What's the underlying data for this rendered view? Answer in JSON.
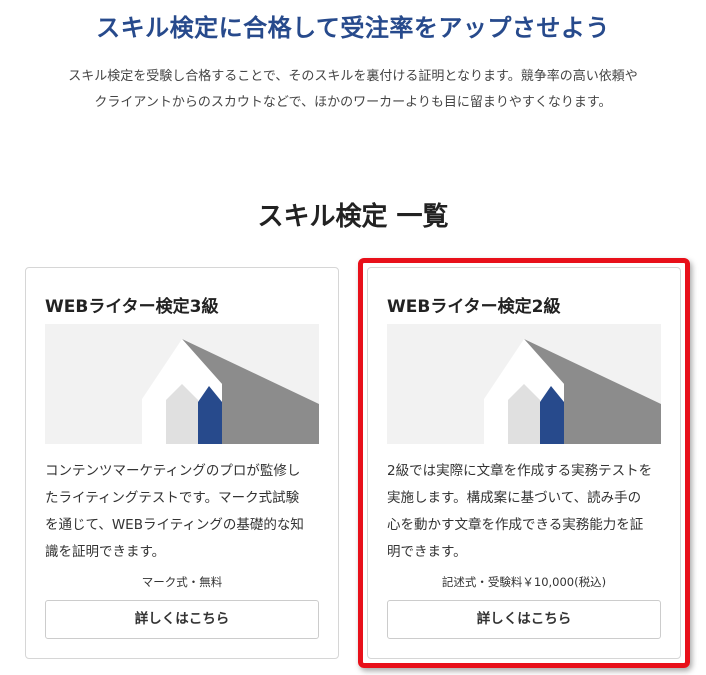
{
  "header": {
    "headline": "スキル検定に合格して受注率をアップさせよう",
    "intro_lines": [
      "スキル検定を受験し合格することで、そのスキルを裏付ける証明となります。競争率の高い依頼や",
      "クライアントからのスカウトなどで、ほかのワーカーよりも目に留まりやすくなります。"
    ]
  },
  "section": {
    "title": "スキル検定 一覧"
  },
  "cards": [
    {
      "title": "WEBライター検定3級",
      "description_lines": [
        "コンテンツマーケティングのプロが監修し",
        "たライティングテストです。マーク式試験",
        "を通じて、WEBライティングの基礎的な知",
        "識を証明できます。"
      ],
      "exam_type": "マーク式・無料",
      "button_label": "詳しくはこちら"
    },
    {
      "title": "WEBライター検定2級",
      "description_lines": [
        "2級では実際に文章を作成する実務テストを",
        "実施します。構成案に基づいて、読み手の",
        "心を動かす文章を作成できる実務能力を証",
        "明できます。"
      ],
      "exam_type": "記述式・受験料￥10,000(税込)",
      "button_label": "詳しくはこちら"
    }
  ],
  "colors": {
    "headline": "#274a8c",
    "accent_blue": "#274a8c",
    "highlight": "#e8101a",
    "thumb_bg": "#f2f2f2",
    "thumb_gray": "#8c8c8c"
  },
  "icons": {
    "card_thumbnail": "house-logo-illustration"
  }
}
